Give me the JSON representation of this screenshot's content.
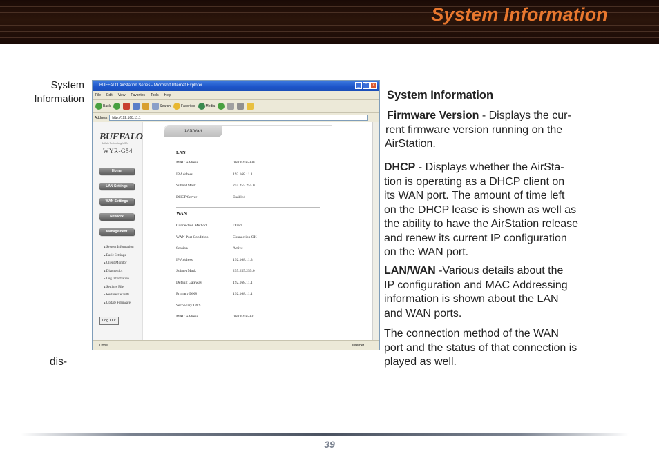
{
  "page": {
    "title": "System Information",
    "caption_line1": "System",
    "caption_line2": "Information",
    "caption_cont": "dis-",
    "page_number": "39"
  },
  "screenshot": {
    "window_title": "BUFFALO AirStation Series - Microsoft Internet Explorer",
    "menu": [
      "File",
      "Edit",
      "View",
      "Favorites",
      "Tools",
      "Help"
    ],
    "toolbar": {
      "back": "Back",
      "search": "Search",
      "favorites": "Favorites",
      "media": "Media"
    },
    "address_label": "Address",
    "address_value": "http://192.168.11.1",
    "status_left": "Done",
    "status_right": "Internet",
    "router": {
      "logo": "BUFFALO",
      "subtitle": "Buffalo Technology USA",
      "model": "WYR-G54",
      "nav": [
        "Home",
        "LAN Settings",
        "WAN Settings",
        "Network",
        "Management"
      ],
      "submenu": [
        "System Information",
        "Basic Settings",
        "Client Monitor",
        "Diagnostics",
        "Log Information",
        "Settings File",
        "Restore Defaults",
        "Update Firmware"
      ],
      "logout": "Log Out",
      "tab": "LAN/WAN",
      "lan_heading": "LAN",
      "lan_rows": [
        {
          "k": "MAC Address",
          "v": "00c002fa5990"
        },
        {
          "k": "IP Address",
          "v": "192.168.11.1"
        },
        {
          "k": "Subnet Mask",
          "v": "255.255.255.0"
        },
        {
          "k": "DHCP Server",
          "v": "Enabled"
        }
      ],
      "wan_heading": "WAN",
      "wan_rows": [
        {
          "k": "Connection Method",
          "v": "Direct"
        },
        {
          "k": "WAN Port Condition",
          "v": "Connection OK"
        },
        {
          "k": "Session",
          "v": "Active"
        },
        {
          "k": "IP Address",
          "v": "192.168.11.3"
        },
        {
          "k": "Subnet Mask",
          "v": "255.255.255.0"
        },
        {
          "k": "Default Gateway",
          "v": "192.168.11.1"
        },
        {
          "k": "Primary DNS",
          "v": "192.168.11.1"
        },
        {
          "k": "Secondary DNS",
          "v": ""
        },
        {
          "k": "MAC Address",
          "v": "00c002fa5991"
        }
      ]
    }
  },
  "text": {
    "heading": "System Information",
    "fw_term": "Firmware Version",
    "fw_l1": " - Displays the cur-",
    "fw_l2": "rent firmware version running on the",
    "fw_l3": "AirStation.",
    "dhcp_term": "DHCP",
    "dhcp_l1": " - Displays whether the AirSta-",
    "dhcp_l2": "tion is operating as a DHCP client on",
    "dhcp_l3": "its WAN port. The amount of time left",
    "dhcp_l4": "on the DHCP lease is shown as well as",
    "dhcp_l5": "the ability to have the AirStation release",
    "dhcp_l6": "and renew its current IP configuration",
    "dhcp_l7": "on the WAN port.",
    "lanwan_term": "LAN/WAN",
    "lanwan_l1": " -Various details about the",
    "lanwan_l2": "IP configuration and MAC Addressing",
    "lanwan_l3": "information is shown about the LAN",
    "lanwan_l4": "and WAN ports.",
    "conn_l1": "The connection method of the WAN",
    "conn_l2": "port and the status of that connection is",
    "conn_l3": "played as well."
  }
}
